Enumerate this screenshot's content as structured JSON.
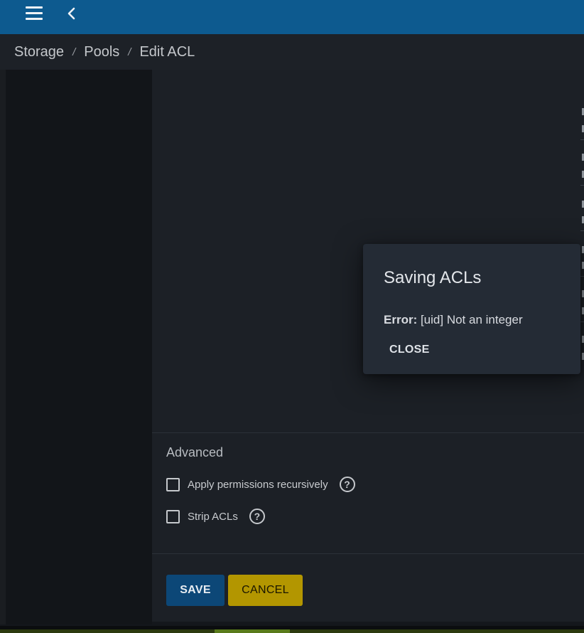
{
  "topbar": {
    "menu_icon": "hamburger-menu-icon",
    "back_icon": "chevron-left-icon",
    "color": "#0d5a8f"
  },
  "breadcrumb": {
    "items": [
      "Storage",
      "Pools",
      "Edit ACL"
    ],
    "separator": "/"
  },
  "advanced": {
    "title": "Advanced",
    "options": [
      {
        "label": "Apply permissions recursively",
        "checked": false,
        "help_icon": "?"
      },
      {
        "label": "Strip ACLs",
        "checked": false,
        "help_icon": "?"
      }
    ]
  },
  "actions": {
    "save_label": "SAVE",
    "cancel_label": "CANCEL",
    "save_color": "#0c4777",
    "cancel_color": "#b39600"
  },
  "dialog": {
    "title": "Saving ACLs",
    "error_prefix": "Error:",
    "error_message": " [uid] Not an integer",
    "close_label": "CLOSE"
  }
}
